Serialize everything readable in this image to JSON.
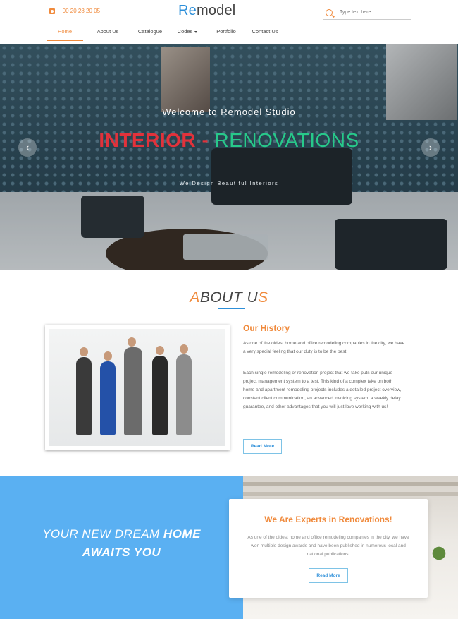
{
  "header": {
    "phone": "+00 20 28 20 05",
    "logo_accent": "Re",
    "logo_rest": "model",
    "search_placeholder": "Type text here..."
  },
  "nav": {
    "items": [
      {
        "label": "Home"
      },
      {
        "label": "About Us"
      },
      {
        "label": "Catalogue"
      },
      {
        "label": "Codes"
      },
      {
        "label": "Portfolio"
      },
      {
        "label": "Contact Us"
      }
    ],
    "active_index": 0
  },
  "hero": {
    "welcome": "Welcome to Remodel Studio",
    "headline_part1": "INTERIOR",
    "headline_dash": " - ",
    "headline_part2": "RENOVATIONS",
    "tagline": "We Design Beautiful Interiors",
    "prev_glyph": "‹",
    "next_glyph": "›"
  },
  "about": {
    "title_a": "A",
    "title_mid": "BOUT U",
    "title_s": "S",
    "history_title": "Our History",
    "paragraph1": "As one of the oldest home and office remodeling companies in the city, we have a very special feeling that our duty is to be the best!",
    "paragraph2": "Each single remodeling or renovation project that we take puts our unique project management system to a test. This kind of a complex take on both home and apartment remodeling projects includes a detailed project overview, constant client communication, an advanced invoicing system, a weekly delay guarantee, and other advantages that you will just love working with us!",
    "read_more": "Read More"
  },
  "dream": {
    "line1_a": "YOUR NEW DREAM ",
    "line1_b": "HOME",
    "line2": "AWAITS YOU"
  },
  "experts": {
    "title": "We Are Experts in Renovations!",
    "text": "As one of the oldest home and office remodeling companies in the city, we have won multiple design awards and have been published in numerous local and national publications.",
    "read_more": "Read More"
  },
  "colors": {
    "accent_orange": "#f08a3c",
    "brand_blue": "#2d8fd9",
    "panel_blue": "#5ab0f2",
    "hero_red": "#e2323b",
    "hero_green": "#27c98a"
  },
  "icons": {
    "phone": "phone-icon",
    "search": "search-icon",
    "caret": "chevron-down-icon",
    "prev": "chevron-left-icon",
    "next": "chevron-right-icon"
  }
}
